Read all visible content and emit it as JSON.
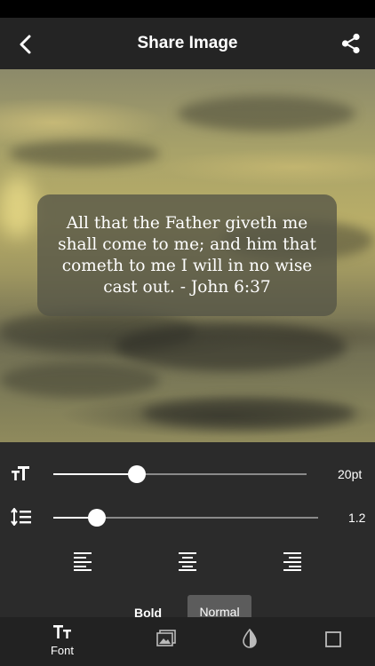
{
  "header": {
    "title": "Share Image",
    "back_icon": "back-chevron-icon",
    "share_icon": "share-icon"
  },
  "quote": {
    "text": "All that the Father giveth me shall come to me; and him that cometh to me I will in no wise cast out. - John 6:37"
  },
  "controls": {
    "font_size": {
      "icon": "text-size-icon",
      "value_label": "20pt",
      "level": 0.33
    },
    "line_spacing": {
      "icon": "line-spacing-icon",
      "value_label": "1.2",
      "level": 0.17
    },
    "alignment": {
      "options": [
        "left",
        "center",
        "right"
      ]
    },
    "weight": {
      "bold_label": "Bold",
      "normal_label": "Normal",
      "selected": "Normal"
    }
  },
  "tabbar": {
    "tabs": [
      {
        "icon": "font-icon",
        "label": "Font",
        "active": true
      },
      {
        "icon": "image-icon",
        "label": "",
        "active": false
      },
      {
        "icon": "contrast-icon",
        "label": "",
        "active": false
      },
      {
        "icon": "frame-icon",
        "label": "",
        "active": false
      }
    ]
  },
  "colors": {
    "background": "#2b2b2b",
    "navbar": "#242424",
    "accent": "#ffffff"
  }
}
